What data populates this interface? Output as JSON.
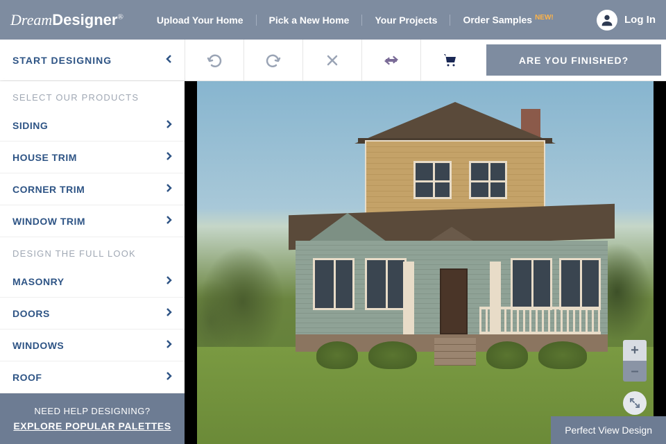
{
  "header": {
    "logo_thin": "Dream",
    "logo_bold": "Designer",
    "nav": [
      "Upload Your Home",
      "Pick a New Home",
      "Your Projects",
      "Order Samples"
    ],
    "new_badge": "NEW!",
    "login": "Log In"
  },
  "toolbar": {
    "start": "START DESIGNING",
    "finished": "ARE YOU FINISHED?"
  },
  "sidebar": {
    "section1_head": "SELECT OUR PRODUCTS",
    "section1_items": [
      "SIDING",
      "HOUSE TRIM",
      "CORNER TRIM",
      "WINDOW TRIM"
    ],
    "section2_head": "DESIGN THE FULL LOOK",
    "section2_items": [
      "MASONRY",
      "DOORS",
      "WINDOWS",
      "ROOF"
    ],
    "help_q": "NEED HELP DESIGNING?",
    "help_cta": "EXPLORE POPULAR PALETTES"
  },
  "canvas": {
    "plus": "+",
    "minus": "–",
    "perfect": "Perfect View Design"
  }
}
